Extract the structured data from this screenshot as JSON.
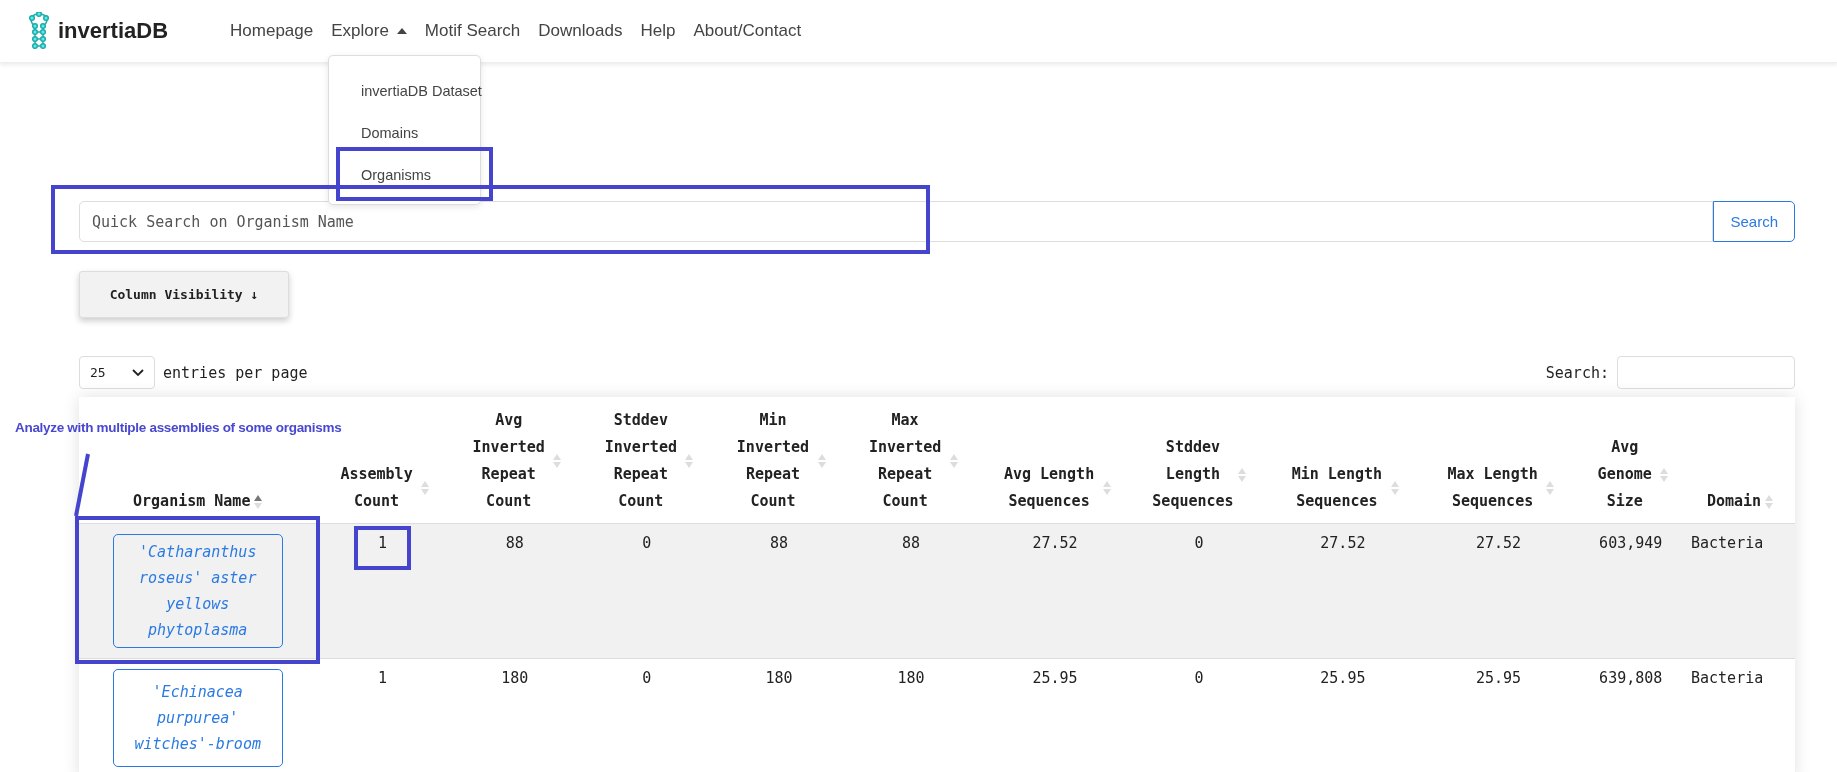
{
  "brand": "invertiaDB",
  "nav": [
    {
      "label": "Homepage",
      "kind": "link"
    },
    {
      "label": "Explore",
      "kind": "dropdown",
      "expanded": true
    },
    {
      "label": "Motif Search",
      "kind": "link"
    },
    {
      "label": "Downloads",
      "kind": "link"
    },
    {
      "label": "Help",
      "kind": "link"
    },
    {
      "label": "About/Contact",
      "kind": "link"
    }
  ],
  "dropdown": [
    "invertiaDB Dataset",
    "Domains",
    "Organisms"
  ],
  "quick_search": {
    "placeholder": "Quick Search on Organism Name",
    "button": "Search"
  },
  "column_visibility": {
    "label": "Column Visibility",
    "arrow": "↓"
  },
  "length": {
    "value": "25",
    "suffix": "entries per page"
  },
  "filter": {
    "label": "Search:"
  },
  "table": {
    "columns": [
      {
        "label": "Organism Name",
        "sorted": true
      },
      {
        "label": "Assembly Count",
        "sorted": false
      },
      {
        "label": "Avg Inverted Repeat Count",
        "sorted": false
      },
      {
        "label": "Stddev Inverted Repeat Count",
        "sorted": false
      },
      {
        "label": "Min Inverted Repeat Count",
        "sorted": false
      },
      {
        "label": "Max Inverted Repeat Count",
        "sorted": false
      },
      {
        "label": "Avg Length Sequences",
        "sorted": false
      },
      {
        "label": "Stddev Length Sequences",
        "sorted": false
      },
      {
        "label": "Min Length Sequences",
        "sorted": false
      },
      {
        "label": "Max Length Sequences",
        "sorted": false
      },
      {
        "label": "Avg Genome Size",
        "sorted": false
      },
      {
        "label": "Domain",
        "sorted": false
      }
    ],
    "rows": [
      {
        "highlighted": true,
        "cells": [
          "'Catharanthus roseus' aster yellows phytoplasma",
          "1",
          "88",
          "0",
          "88",
          "88",
          "27.52",
          "0",
          "27.52",
          "27.52",
          "603,949",
          "Bacteria"
        ]
      },
      {
        "highlighted": false,
        "cells": [
          "'Echinacea purpurea' witches'-broom",
          "1",
          "180",
          "0",
          "180",
          "180",
          "25.95",
          "0",
          "25.95",
          "25.95",
          "639,808",
          "Bacteria"
        ]
      }
    ]
  },
  "annotation": {
    "label": "Analyze with multiple assemblies of some organisms"
  }
}
